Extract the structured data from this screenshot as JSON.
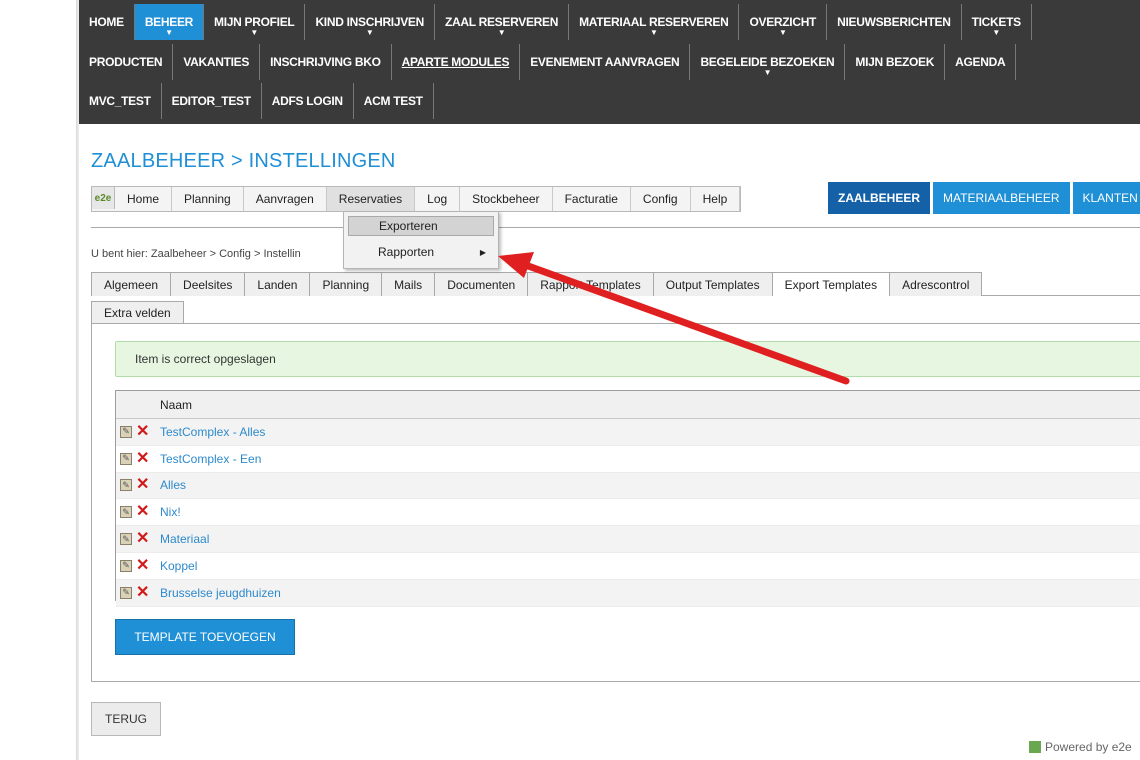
{
  "nav": {
    "row1": [
      {
        "label": "HOME",
        "active": false,
        "chevron": false
      },
      {
        "label": "BEHEER",
        "active": true,
        "chevron": true
      },
      {
        "label": "MIJN PROFIEL",
        "active": false,
        "chevron": true
      },
      {
        "label": "KIND INSCHRIJVEN",
        "active": false,
        "chevron": true
      },
      {
        "label": "ZAAL RESERVEREN",
        "active": false,
        "chevron": true
      },
      {
        "label": "MATERIAAL RESERVEREN",
        "active": false,
        "chevron": true
      },
      {
        "label": "OVERZICHT",
        "active": false,
        "chevron": true
      },
      {
        "label": "NIEUWSBERICHTEN",
        "active": false,
        "chevron": false
      },
      {
        "label": "TICKETS",
        "active": false,
        "chevron": true
      }
    ],
    "row2": [
      {
        "label": "PRODUCTEN"
      },
      {
        "label": "VAKANTIES"
      },
      {
        "label": "INSCHRIJVING BKO"
      },
      {
        "label": "APARTE MODULES",
        "underline": true
      },
      {
        "label": "EVENEMENT AANVRAGEN"
      },
      {
        "label": "BEGELEIDE BEZOEKEN",
        "chevron": true
      },
      {
        "label": "MIJN BEZOEK"
      },
      {
        "label": "AGENDA"
      }
    ],
    "row3": [
      {
        "label": "MVC_TEST"
      },
      {
        "label": "EDITOR_TEST"
      },
      {
        "label": "ADFS LOGIN"
      },
      {
        "label": "ACM TEST"
      }
    ]
  },
  "page": {
    "title": "ZAALBEHEER > INSTELLINGEN",
    "breadcrumb": "U bent hier: Zaalbeheer > Config > Instellin"
  },
  "apptoolbar": {
    "logo": "e2e",
    "items": [
      "Home",
      "Planning",
      "Aanvragen",
      "Reservaties",
      "Log",
      "Stockbeheer",
      "Facturatie",
      "Config",
      "Help"
    ]
  },
  "modules": [
    "ZAALBEHEER",
    "MATERIAALBEHEER",
    "KLANTEN"
  ],
  "dropdown": {
    "items": [
      {
        "label": "Exporteren",
        "highlight": true
      },
      {
        "label": "Rapporten",
        "submenu": true
      }
    ]
  },
  "tabs": {
    "row1": [
      "Algemeen",
      "Deelsites",
      "Landen",
      "Planning",
      "Mails",
      "Documenten",
      "Rapport Templates",
      "Output Templates",
      "Export Templates",
      "Adrescontrol"
    ],
    "active": "Export Templates",
    "row2": [
      "Extra velden"
    ]
  },
  "success_message": "Item is correct opgeslagen",
  "grid": {
    "header": "Naam",
    "rows": [
      "TestComplex - Alles",
      "TestComplex - Een",
      "Alles",
      "Nix!",
      "Materiaal",
      "Koppel",
      "Brusselse jeugdhuizen"
    ]
  },
  "buttons": {
    "add_template": "TEMPLATE TOEVOEGEN",
    "back": "TERUG"
  },
  "footer": {
    "powered": "Powered by e2e"
  },
  "colors": {
    "nav_bg": "#3a3a3a",
    "accent": "#1f8fd6",
    "accent_dark": "#1461a8",
    "success_bg": "#e6f6e1",
    "delete_red": "#d01a1a",
    "annotation_arrow": "#e02020"
  }
}
